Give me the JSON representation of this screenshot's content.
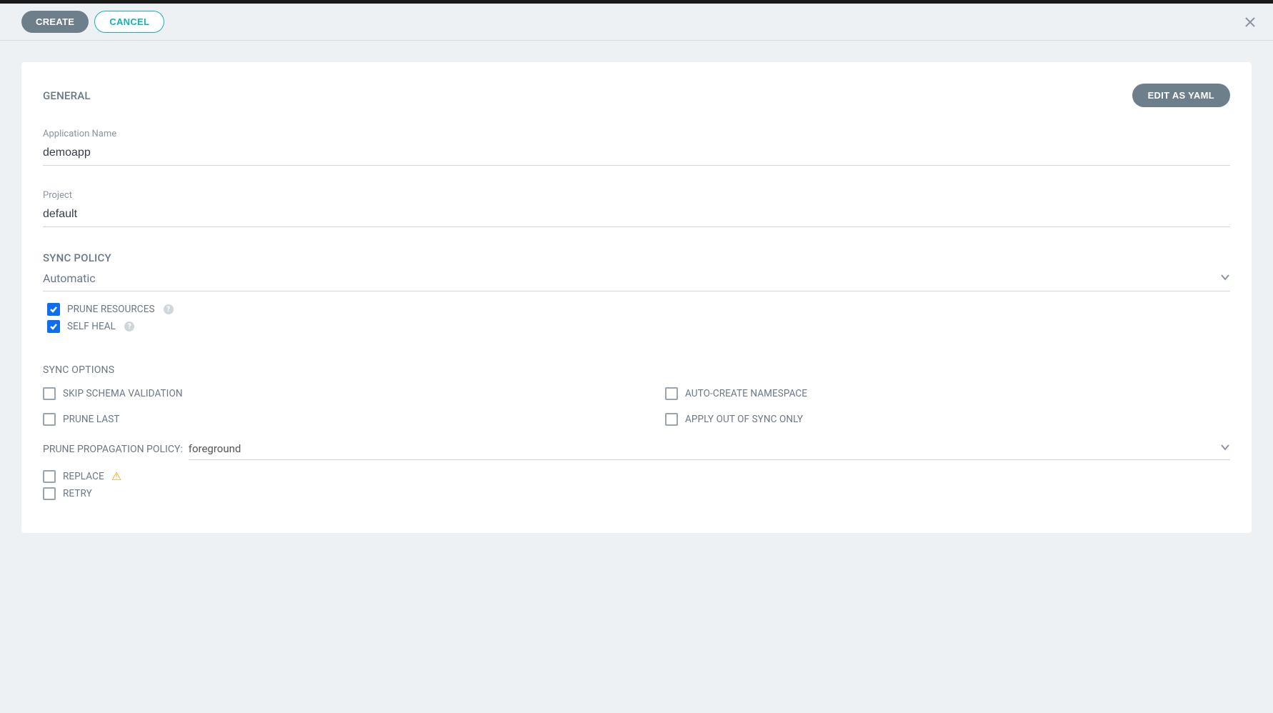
{
  "toolbar": {
    "create_label": "CREATE",
    "cancel_label": "CANCEL"
  },
  "card": {
    "general_title": "GENERAL",
    "edit_yaml_label": "EDIT AS YAML",
    "app_name_label": "Application Name",
    "app_name_value": "demoapp",
    "project_label": "Project",
    "project_value": "default",
    "sync_policy_title": "SYNC POLICY",
    "sync_policy_value": "Automatic",
    "prune_resources_label": "PRUNE RESOURCES",
    "self_heal_label": "SELF HEAL",
    "sync_options_title": "SYNC OPTIONS",
    "skip_schema_label": "SKIP SCHEMA VALIDATION",
    "auto_create_ns_label": "AUTO-CREATE NAMESPACE",
    "prune_last_label": "PRUNE LAST",
    "apply_out_of_sync_label": "APPLY OUT OF SYNC ONLY",
    "prune_propagation_label": "PRUNE PROPAGATION POLICY:",
    "prune_propagation_value": "foreground",
    "replace_label": "REPLACE",
    "retry_label": "RETRY"
  }
}
